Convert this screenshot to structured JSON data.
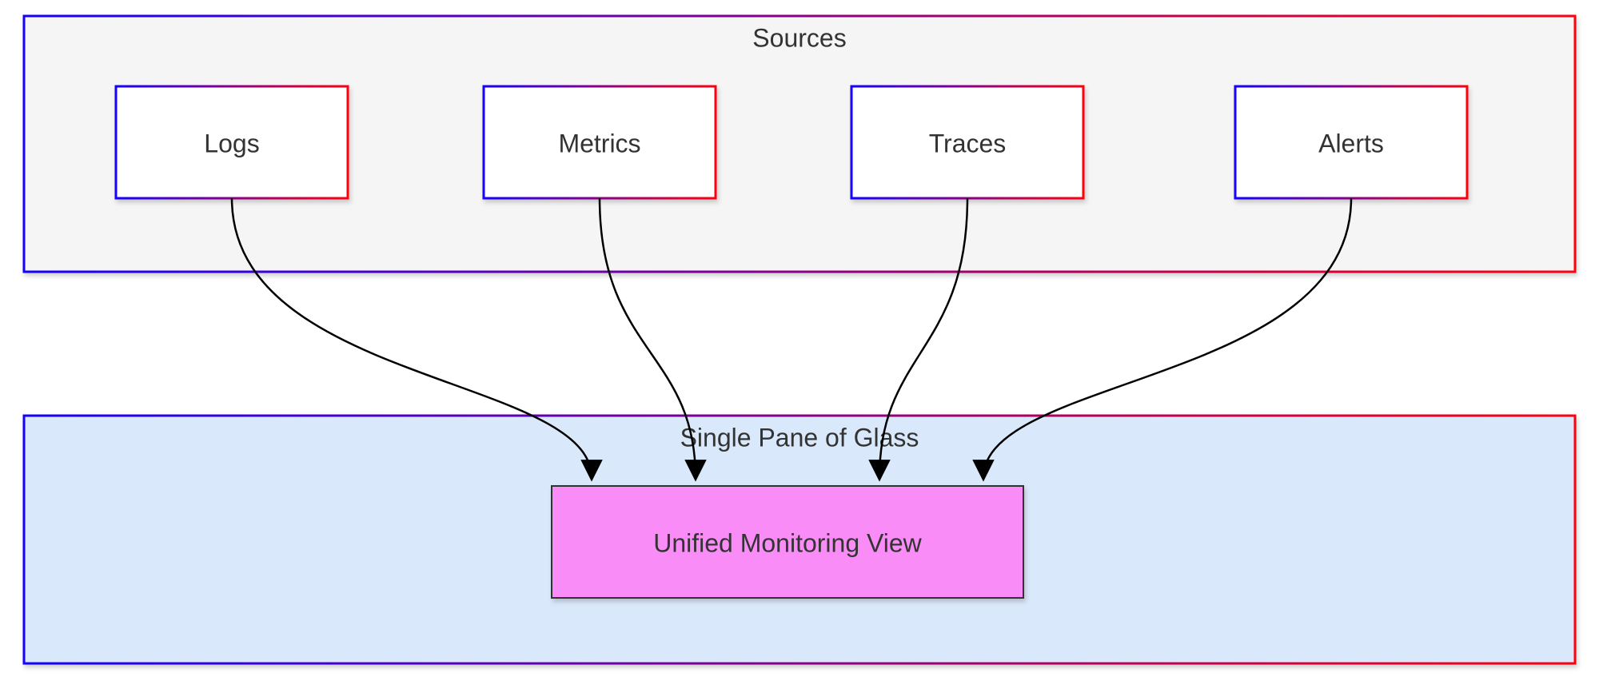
{
  "diagram": {
    "containers": {
      "sources": {
        "label": "Sources",
        "fill": "#f5f5f5",
        "nodes": [
          {
            "id": "logs",
            "label": "Logs"
          },
          {
            "id": "metrics",
            "label": "Metrics"
          },
          {
            "id": "traces",
            "label": "Traces"
          },
          {
            "id": "alerts",
            "label": "Alerts"
          }
        ]
      },
      "spog": {
        "label": "Single Pane of Glass",
        "fill": "#dae8fc",
        "nodes": [
          {
            "id": "unified",
            "label": "Unified Monitoring View",
            "fill": "#fa8cf7"
          }
        ]
      }
    },
    "edges": [
      {
        "from": "logs",
        "to": "unified"
      },
      {
        "from": "metrics",
        "to": "unified"
      },
      {
        "from": "traces",
        "to": "unified"
      },
      {
        "from": "alerts",
        "to": "unified"
      }
    ],
    "colors": {
      "gradientStart": "#1500ff",
      "gradientEnd": "#ff0010",
      "nodeFill": "#ffffff",
      "arrow": "#000000"
    }
  }
}
